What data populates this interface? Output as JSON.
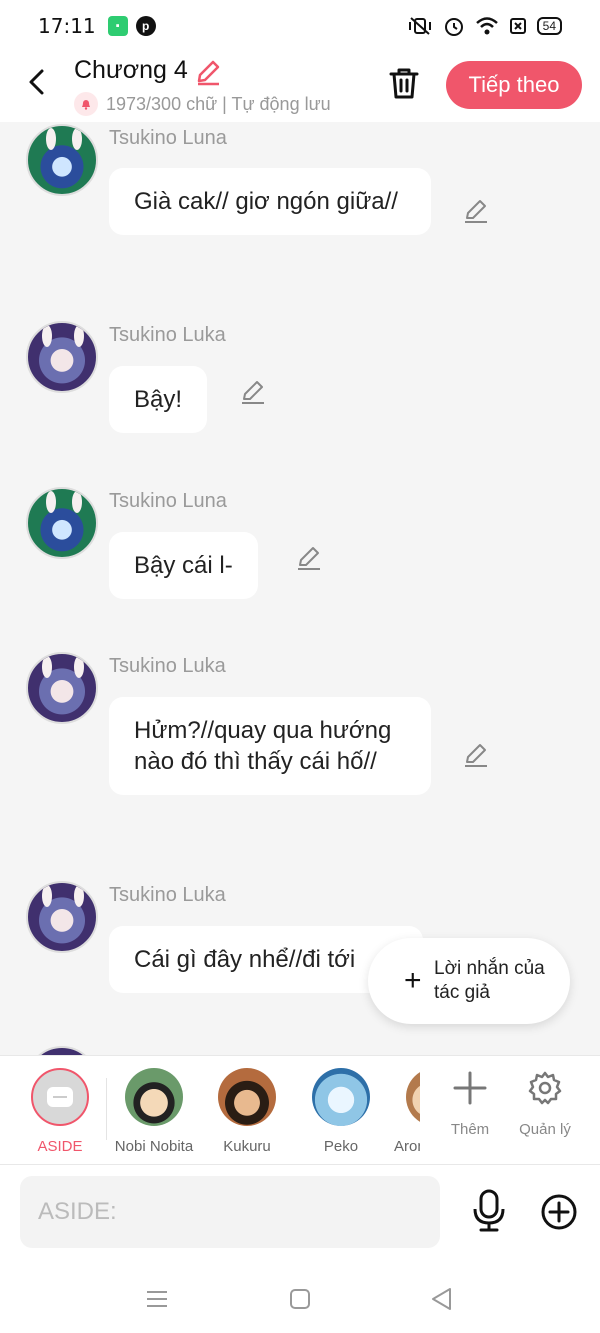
{
  "status_bar": {
    "time": "17:11",
    "battery": "54",
    "left_icons": [
      "app-icon",
      "pinterest-icon"
    ],
    "right_icons": [
      "mute-vibrate-icon",
      "alarm-icon",
      "wifi-icon",
      "sim-icon",
      "battery-icon"
    ]
  },
  "header": {
    "title": "Chương 4",
    "word_count": "1973/300 chữ | Tự động lưu",
    "next_label": "Tiếp theo"
  },
  "messages": [
    {
      "sender": "Tsukino Luna",
      "text": "Già cak// giơ ngón giữa//"
    },
    {
      "sender": "Tsukino Luka",
      "text": "Bậy!"
    },
    {
      "sender": "Tsukino Luna",
      "text": "Bậy cái l-"
    },
    {
      "sender": "Tsukino Luka",
      "text": "Hửm?//quay qua hướng nào đó thì thấy cái hố//"
    },
    {
      "sender": "Tsukino Luka",
      "text": "Cái gì đây nhể//đi tới"
    }
  ],
  "author_note": {
    "label": "Lời nhắn của tác giả"
  },
  "characters": [
    {
      "name": "ASIDE",
      "active": true
    },
    {
      "name": "Nobi Nobita"
    },
    {
      "name": "Kukuru"
    },
    {
      "name": "Peko"
    },
    {
      "name": "Aron"
    }
  ],
  "tools": {
    "add_label": "Thêm",
    "manage_label": "Quản lý"
  },
  "composer": {
    "placeholder": "ASIDE:"
  },
  "colors": {
    "accent": "#f0566b",
    "background": "#f5f5f5",
    "bubble": "#ffffff"
  }
}
